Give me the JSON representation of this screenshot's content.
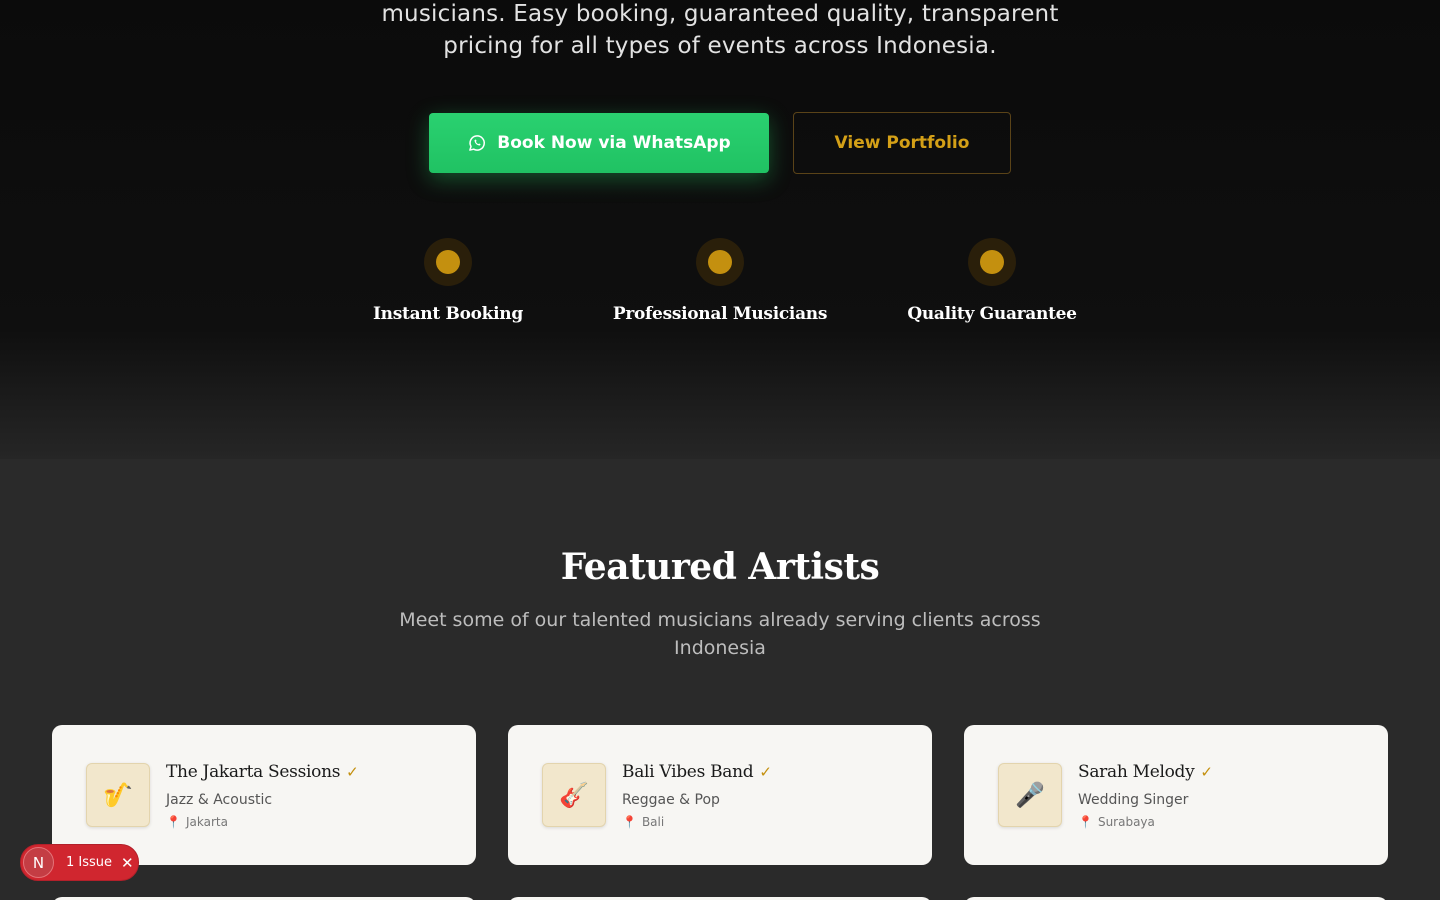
{
  "hero": {
    "description": "musicians. Easy booking, guaranteed quality, transparent pricing for all types of events across Indonesia.",
    "primary_button": "Book Now via WhatsApp",
    "secondary_button": "View Portfolio",
    "features": [
      {
        "title": "Instant Booking"
      },
      {
        "title": "Professional Musicians"
      },
      {
        "title": "Quality Guarantee"
      }
    ]
  },
  "featured": {
    "title": "Featured Artists",
    "subtitle": "Meet some of our talented musicians already serving clients across Indonesia",
    "artists": [
      {
        "name": "The Jakarta Sessions",
        "verified": "✓",
        "genre": "Jazz & Acoustic",
        "location": "Jakarta",
        "icon": "🎷",
        "icon_name": "saxophone-icon"
      },
      {
        "name": "Bali Vibes Band",
        "verified": "✓",
        "genre": "Reggae & Pop",
        "location": "Bali",
        "icon": "🎸",
        "icon_name": "guitar-icon"
      },
      {
        "name": "Sarah Melody",
        "verified": "✓",
        "genre": "Wedding Singer",
        "location": "Surabaya",
        "icon": "🎤",
        "icon_name": "microphone-icon"
      }
    ]
  },
  "dev_overlay": {
    "logo": "N",
    "issues_label": "1 Issue",
    "close": "✕"
  },
  "colors": {
    "accent_gold": "#c4900f",
    "whatsapp_green": "#25d366",
    "issue_red": "#d0262f"
  }
}
